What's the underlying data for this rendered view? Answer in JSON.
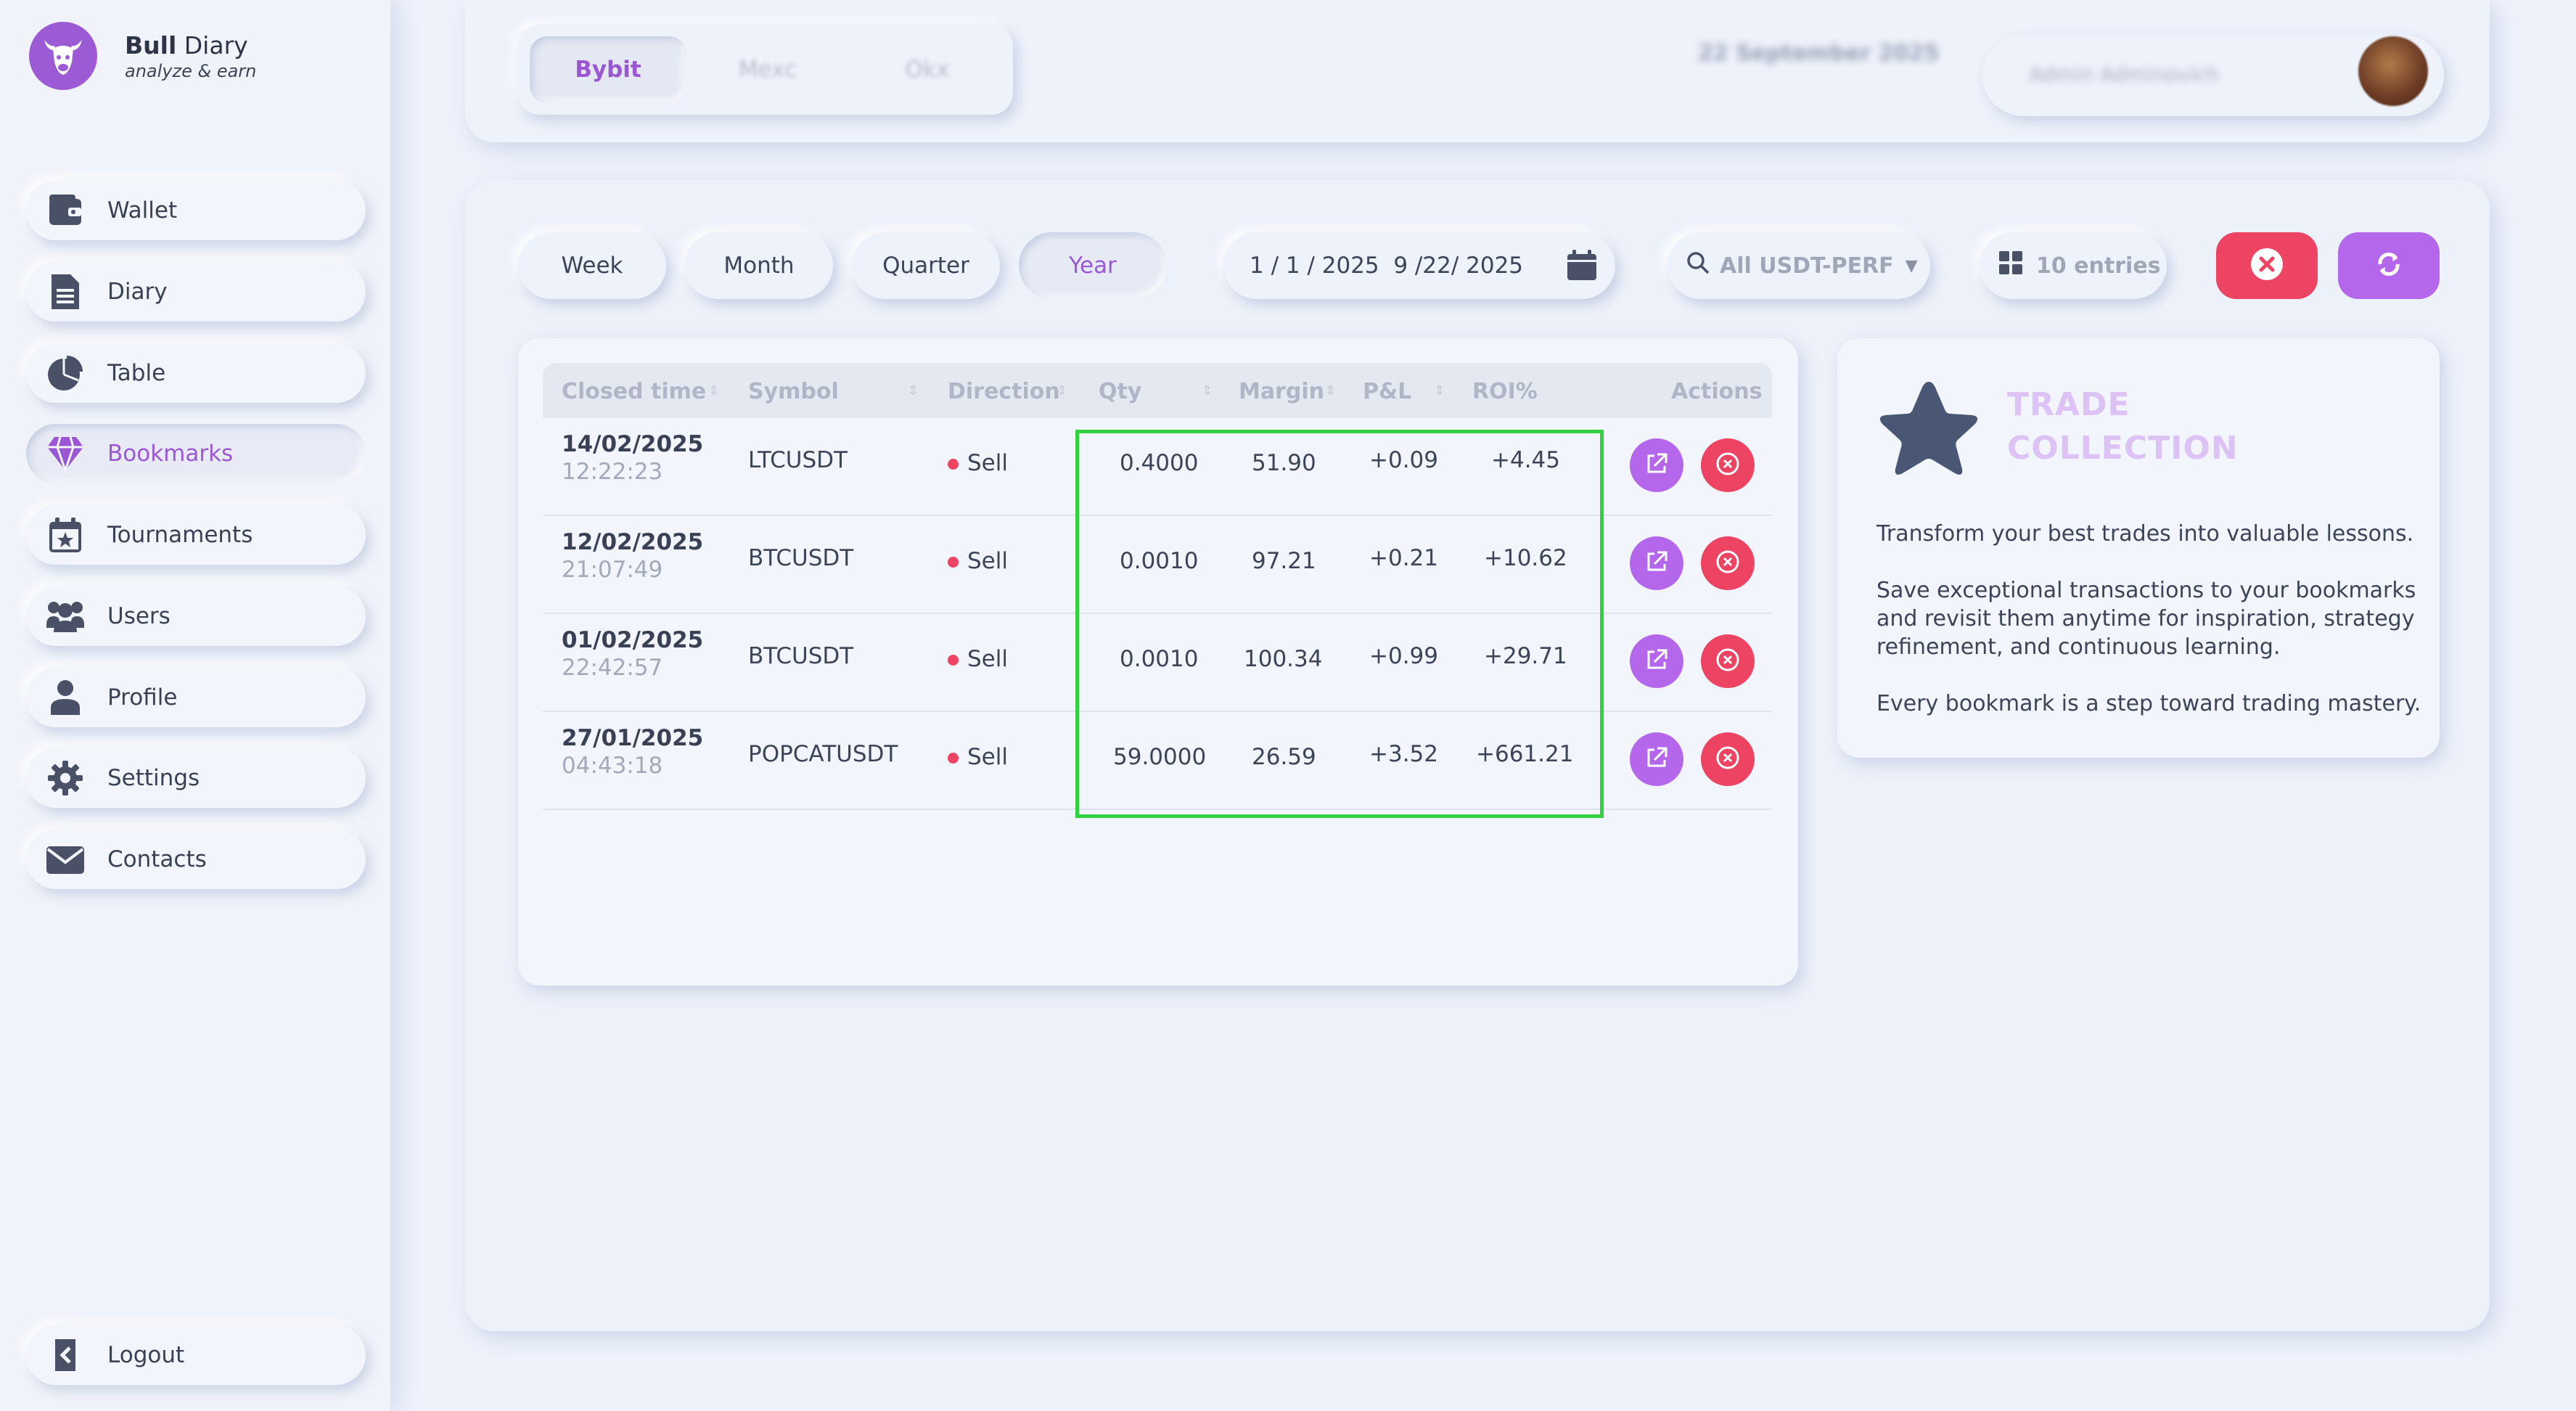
{
  "brand": {
    "name_bold": "Bull",
    "name_rest": " Diary",
    "tagline": "analyze & earn",
    "accent": "#9b57d3"
  },
  "sidebar": {
    "items": [
      {
        "label": "Wallet",
        "icon": "wallet-icon"
      },
      {
        "label": "Diary",
        "icon": "document-icon"
      },
      {
        "label": "Table",
        "icon": "pie-chart-icon"
      },
      {
        "label": "Bookmarks",
        "icon": "gem-icon",
        "active": true
      },
      {
        "label": "Tournaments",
        "icon": "calendar-star-icon"
      },
      {
        "label": "Users",
        "icon": "users-icon"
      },
      {
        "label": "Profile",
        "icon": "person-icon"
      },
      {
        "label": "Settings",
        "icon": "gear-icon"
      },
      {
        "label": "Contacts",
        "icon": "envelope-icon"
      }
    ],
    "logout": {
      "label": "Logout",
      "icon": "logout-icon"
    }
  },
  "topbar": {
    "exchanges": [
      {
        "label": "Bybit",
        "active": true
      },
      {
        "label": "Mexc",
        "active": false
      },
      {
        "label": "Okx",
        "active": false
      }
    ],
    "date": "22 September 2025",
    "user_name": "Admin Adminovich"
  },
  "filters": {
    "periods": [
      "Week",
      "Month",
      "Quarter",
      "Year"
    ],
    "active_period": "Year",
    "date_range": "1 / 1 / 2025  9 /22/ 2025",
    "symbol_filter": "All USDT-PERF",
    "entries": "10 entries"
  },
  "table": {
    "columns": [
      "Closed time",
      "Symbol",
      "Direction",
      "Qty",
      "Margin",
      "P&L",
      "ROI%",
      "Actions"
    ],
    "rows": [
      {
        "date": "14/02/2025",
        "time": "12:22:23",
        "symbol": "LTCUSDT",
        "direction": "Sell",
        "qty": "0.4000",
        "margin": "51.90",
        "pnl": "+0.09",
        "roi": "+4.45"
      },
      {
        "date": "12/02/2025",
        "time": "21:07:49",
        "symbol": "BTCUSDT",
        "direction": "Sell",
        "qty": "0.0010",
        "margin": "97.21",
        "pnl": "+0.21",
        "roi": "+10.62"
      },
      {
        "date": "01/02/2025",
        "time": "22:42:57",
        "symbol": "BTCUSDT",
        "direction": "Sell",
        "qty": "0.0010",
        "margin": "100.34",
        "pnl": "+0.99",
        "roi": "+29.71"
      },
      {
        "date": "27/01/2025",
        "time": "04:43:18",
        "symbol": "POPCATUSDT",
        "direction": "Sell",
        "qty": "59.0000",
        "margin": "26.59",
        "pnl": "+3.52",
        "roi": "+661.21"
      }
    ]
  },
  "info": {
    "title_line1": "TRADE",
    "title_line2": "COLLECTION",
    "p1": "Transform your best trades into valuable lessons.",
    "p2": "Save exceptional transactions to your bookmarks and revisit them anytime for inspiration, strategy refinement, and continuous learning.",
    "p3": "Every bookmark is a step toward trading mastery."
  },
  "colors": {
    "red": "#ee4463",
    "purple": "#b467ea",
    "highlight": "#33d040"
  }
}
